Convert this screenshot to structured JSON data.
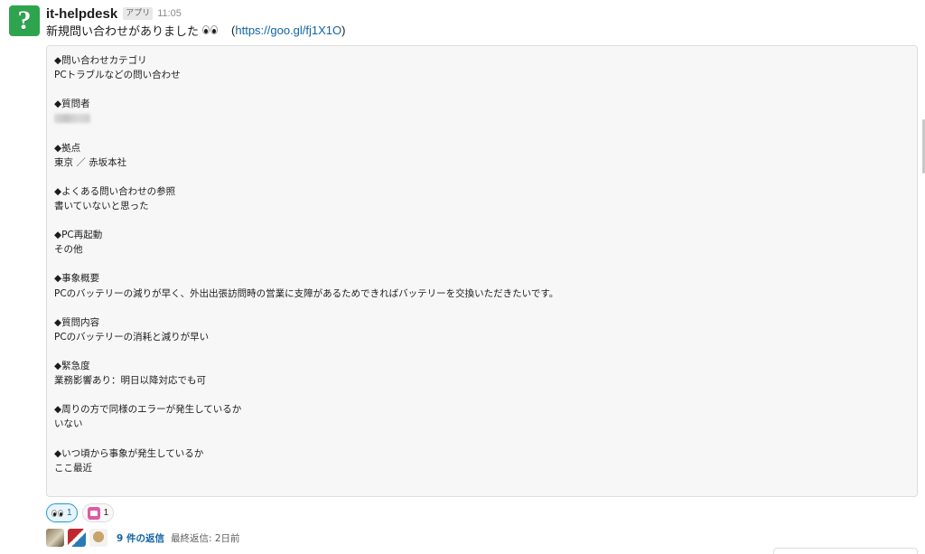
{
  "message": {
    "bot_name": "it-helpdesk",
    "app_badge": "アプリ",
    "time": "11:05",
    "text": "新規問い合わせがありました",
    "emoji": "eyes-icon",
    "link_open": "(",
    "link_text": "https://goo.gl/fj1X1O",
    "link_close": ")"
  },
  "attachment": {
    "fields": [
      {
        "title": "◆問い合わせカテゴリ",
        "value": "PCトラブルなどの問い合わせ"
      },
      {
        "title": "◆質問者",
        "value": "",
        "redacted": true
      },
      {
        "title": "◆拠点",
        "value": "東京 ／ 赤坂本社"
      },
      {
        "title": "◆よくある問い合わせの参照",
        "value": "書いていないと思った"
      },
      {
        "title": "◆PC再起動",
        "value": "その他"
      },
      {
        "title": "◆事象概要",
        "value": "PCのバッテリーの減りが早く、外出出張訪問時の営業に支障があるためできればバッテリーを交換いただきたいです。"
      },
      {
        "title": "◆質問内容",
        "value": "PCのバッテリーの消耗と減りが早い"
      },
      {
        "title": "◆緊急度",
        "value": "業務影響あり：明日以降対応でも可"
      },
      {
        "title": "◆周りの方で同様のエラーが発生しているか",
        "value": "いない"
      },
      {
        "title": "◆いつ頃から事象が発生しているか",
        "value": "ここ最近"
      }
    ]
  },
  "reactions": [
    {
      "emoji": "eyes-icon",
      "count": "1",
      "mine": true
    },
    {
      "emoji": "pink-emoji-icon",
      "count": "1",
      "mine": false
    }
  ],
  "thread": {
    "reply_count": "9 件の返信",
    "last_reply": "最終返信: 2日前"
  },
  "colors": {
    "link": "#1264a3",
    "avatar": "#2ea44f",
    "attachment_bg": "#f7f7f7"
  }
}
